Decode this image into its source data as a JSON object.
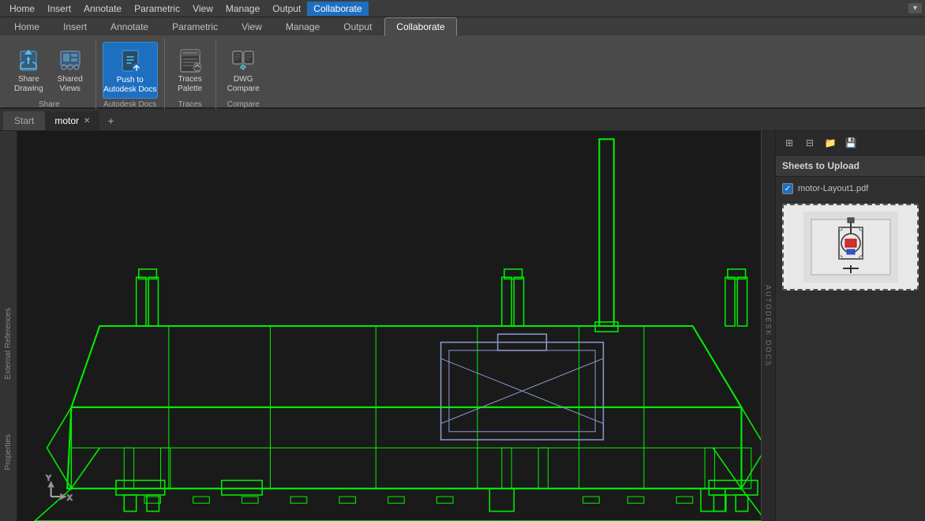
{
  "menubar": {
    "items": [
      "Home",
      "Insert",
      "Annotate",
      "Parametric",
      "View",
      "Manage",
      "Output",
      "Collaborate"
    ],
    "active": "Collaborate",
    "quick_access": "▾"
  },
  "ribbon": {
    "active_tab": "Collaborate",
    "groups": [
      {
        "label": "Share",
        "items": [
          {
            "id": "share-drawing",
            "label": "Share\nDrawing",
            "icon": "✈",
            "active": false
          },
          {
            "id": "shared-views",
            "label": "Shared\nViews",
            "icon": "👁",
            "active": false
          }
        ],
        "sub_label": "Share"
      },
      {
        "label": "Autodesk Docs",
        "items": [
          {
            "id": "push-to-autodesk-docs",
            "label": "Push to\nAutodesk Docs",
            "icon": "☁",
            "active": true
          }
        ],
        "sub_label": "Autodesk Docs"
      },
      {
        "label": "Traces",
        "items": [
          {
            "id": "traces-palette",
            "label": "Traces\nPalette",
            "icon": "📋",
            "active": false
          }
        ],
        "sub_label": "Traces"
      },
      {
        "label": "Compare",
        "items": [
          {
            "id": "dwg-compare",
            "label": "DWG\nCompare",
            "icon": "⊞",
            "active": false
          }
        ],
        "sub_label": "Compare"
      }
    ]
  },
  "tabs": {
    "items": [
      {
        "id": "start",
        "label": "Start",
        "active": false,
        "closeable": false
      },
      {
        "id": "motor",
        "label": "motor",
        "active": true,
        "closeable": true
      }
    ],
    "add_button": "+"
  },
  "canvas": {
    "background": "#1a1a1a",
    "compass": "⊕",
    "autodesk_docs_label": "AUTODESK DOCS"
  },
  "right_panel": {
    "title": "Sheets to Upload",
    "icons": [
      "⊞",
      "⊟",
      "📁",
      "💾"
    ],
    "sheets": [
      {
        "id": "motor-layout1",
        "name": "motor-Layout1.pdf",
        "checked": true
      }
    ]
  },
  "side_panels": {
    "external_references": "External References",
    "properties": "Properties"
  },
  "colors": {
    "accent_blue": "#1e6fc0",
    "cad_green": "#00ff00",
    "cad_blue_gray": "#8899aa",
    "bg_dark": "#1a1a1a",
    "ribbon_bg": "#4a4a4a",
    "ribbon_active": "#1e6fc0",
    "panel_bg": "#2f2f2f"
  }
}
